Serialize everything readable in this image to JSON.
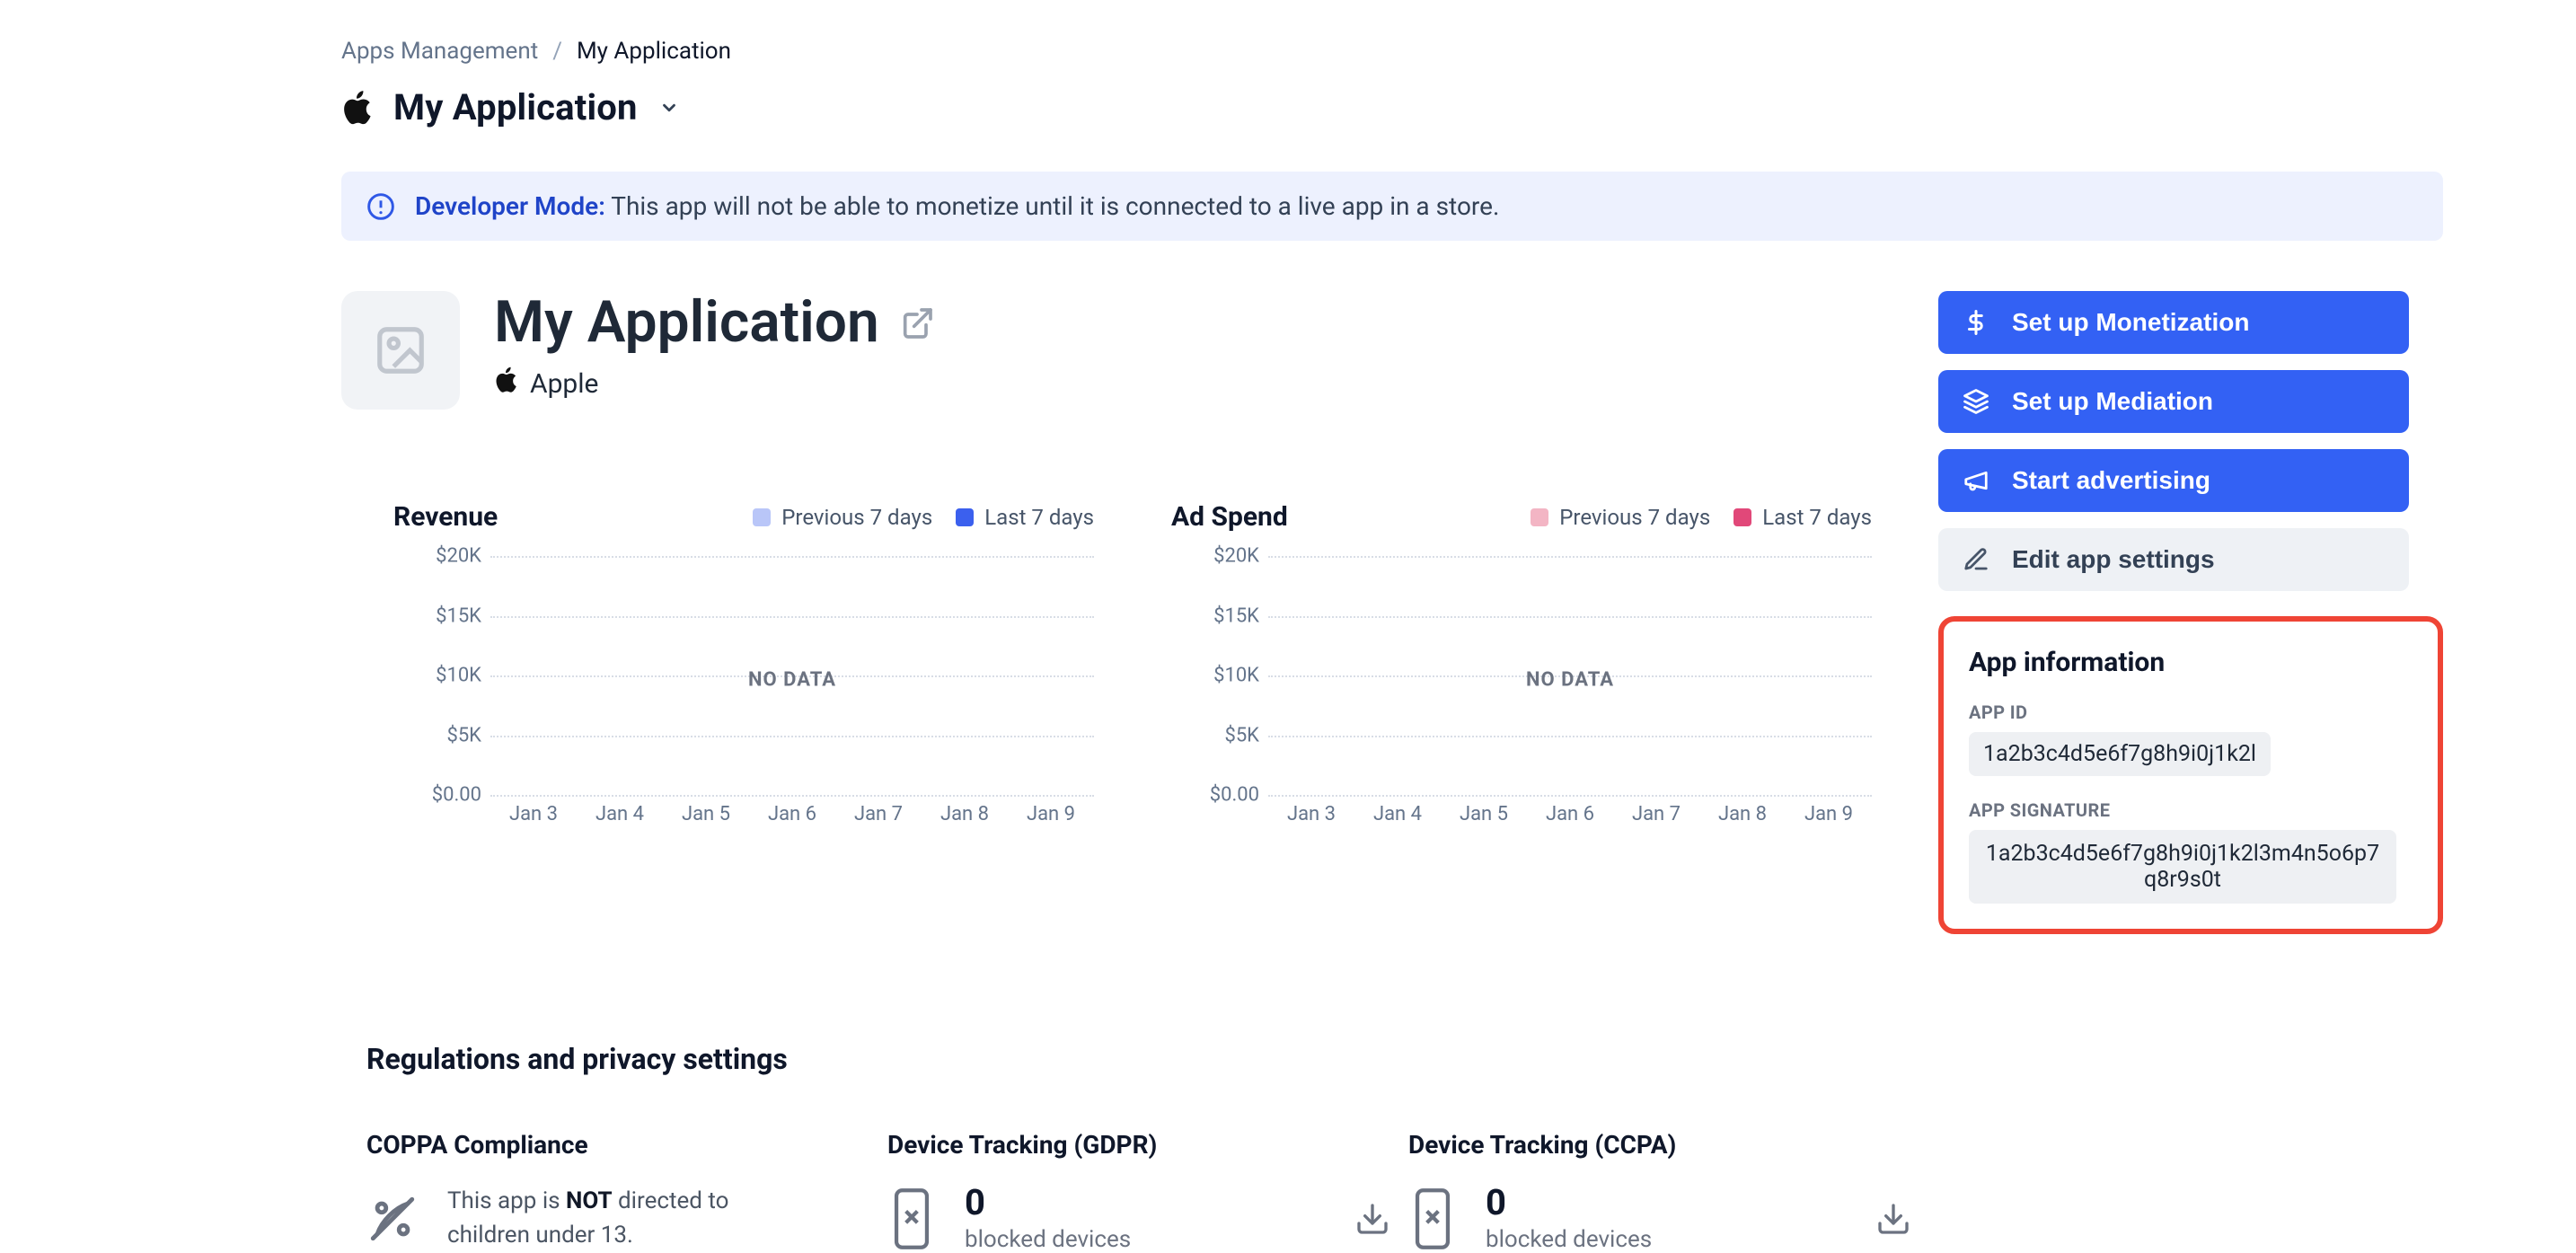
{
  "breadcrumb": {
    "root": "Apps Management",
    "current": "My Application"
  },
  "page_title": "My Application",
  "alert": {
    "label": "Developer Mode:",
    "text": "This app will not be able to monetize until it is connected to a live app in a store."
  },
  "hero": {
    "app_name": "My Application",
    "platform": "Apple"
  },
  "actions": {
    "monetization": "Set up Monetization",
    "mediation": "Set up Mediation",
    "advertising": "Start advertising",
    "edit": "Edit app settings"
  },
  "charts": {
    "revenue": {
      "title": "Revenue",
      "legend_prev": "Previous 7 days",
      "legend_last": "Last 7 days",
      "nodata": "NO DATA"
    },
    "adspend": {
      "title": "Ad Spend",
      "legend_prev": "Previous 7 days",
      "legend_last": "Last 7 days",
      "nodata": "NO DATA"
    },
    "yticks": [
      "$20K",
      "$15K",
      "$10K",
      "$5K",
      "$0.00"
    ],
    "xticks": [
      "Jan 3",
      "Jan 4",
      "Jan 5",
      "Jan 6",
      "Jan 7",
      "Jan 8",
      "Jan 9"
    ]
  },
  "app_info": {
    "title": "App information",
    "app_id_label": "APP ID",
    "app_id": "1a2b3c4d5e6f7g8h9i0j1k2l",
    "app_sig_label": "APP SIGNATURE",
    "app_sig": "1a2b3c4d5e6f7g8h9i0j1k2l3m4n5o6p7q8r9s0t"
  },
  "regulations": {
    "title": "Regulations and privacy settings",
    "coppa": {
      "title": "COPPA Compliance",
      "text_pre": "This app is ",
      "text_bold": "NOT",
      "text_post": " directed to children under 13."
    },
    "gdpr": {
      "title": "Device Tracking (GDPR)",
      "count": "0",
      "sub": "blocked devices"
    },
    "ccpa": {
      "title": "Device Tracking (CCPA)",
      "count": "0",
      "sub": "blocked devices"
    }
  },
  "chart_data": [
    {
      "type": "line",
      "title": "Revenue",
      "series": [
        {
          "name": "Previous 7 days",
          "x": [
            "Jan 3",
            "Jan 4",
            "Jan 5",
            "Jan 6",
            "Jan 7",
            "Jan 8",
            "Jan 9"
          ],
          "y": [
            null,
            null,
            null,
            null,
            null,
            null,
            null
          ]
        },
        {
          "name": "Last 7 days",
          "x": [
            "Jan 3",
            "Jan 4",
            "Jan 5",
            "Jan 6",
            "Jan 7",
            "Jan 8",
            "Jan 9"
          ],
          "y": [
            null,
            null,
            null,
            null,
            null,
            null,
            null
          ]
        }
      ],
      "ylabel": "USD",
      "ylim": [
        0,
        20000
      ],
      "yticks": [
        0,
        5000,
        10000,
        15000,
        20000
      ],
      "note": "NO DATA"
    },
    {
      "type": "line",
      "title": "Ad Spend",
      "series": [
        {
          "name": "Previous 7 days",
          "x": [
            "Jan 3",
            "Jan 4",
            "Jan 5",
            "Jan 6",
            "Jan 7",
            "Jan 8",
            "Jan 9"
          ],
          "y": [
            null,
            null,
            null,
            null,
            null,
            null,
            null
          ]
        },
        {
          "name": "Last 7 days",
          "x": [
            "Jan 3",
            "Jan 4",
            "Jan 5",
            "Jan 6",
            "Jan 7",
            "Jan 8",
            "Jan 9"
          ],
          "y": [
            null,
            null,
            null,
            null,
            null,
            null,
            null
          ]
        }
      ],
      "ylabel": "USD",
      "ylim": [
        0,
        20000
      ],
      "yticks": [
        0,
        5000,
        10000,
        15000,
        20000
      ],
      "note": "NO DATA"
    }
  ]
}
